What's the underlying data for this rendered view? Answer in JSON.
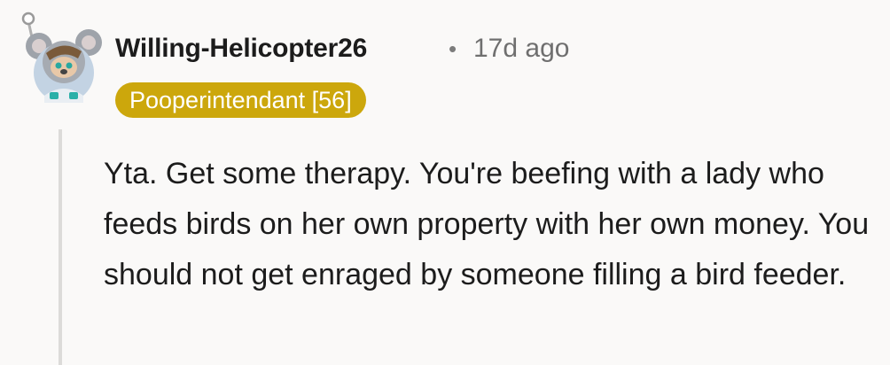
{
  "comment": {
    "author": "Willing-Helicopter26",
    "separator": "•",
    "timestamp": "17d ago",
    "flair": "Pooperintendant [56]",
    "avatar_icon": "koala-avatar-icon",
    "body": "Yta. Get some therapy. You're beefing with a lady who feeds birds on her own property with her own money. You should not get enraged by someone filling a bird feeder."
  },
  "colors": {
    "flair_background": "#cca70c",
    "flair_text": "#ffffff",
    "background": "#faf9f8",
    "thread_line": "#dcdbd9"
  }
}
